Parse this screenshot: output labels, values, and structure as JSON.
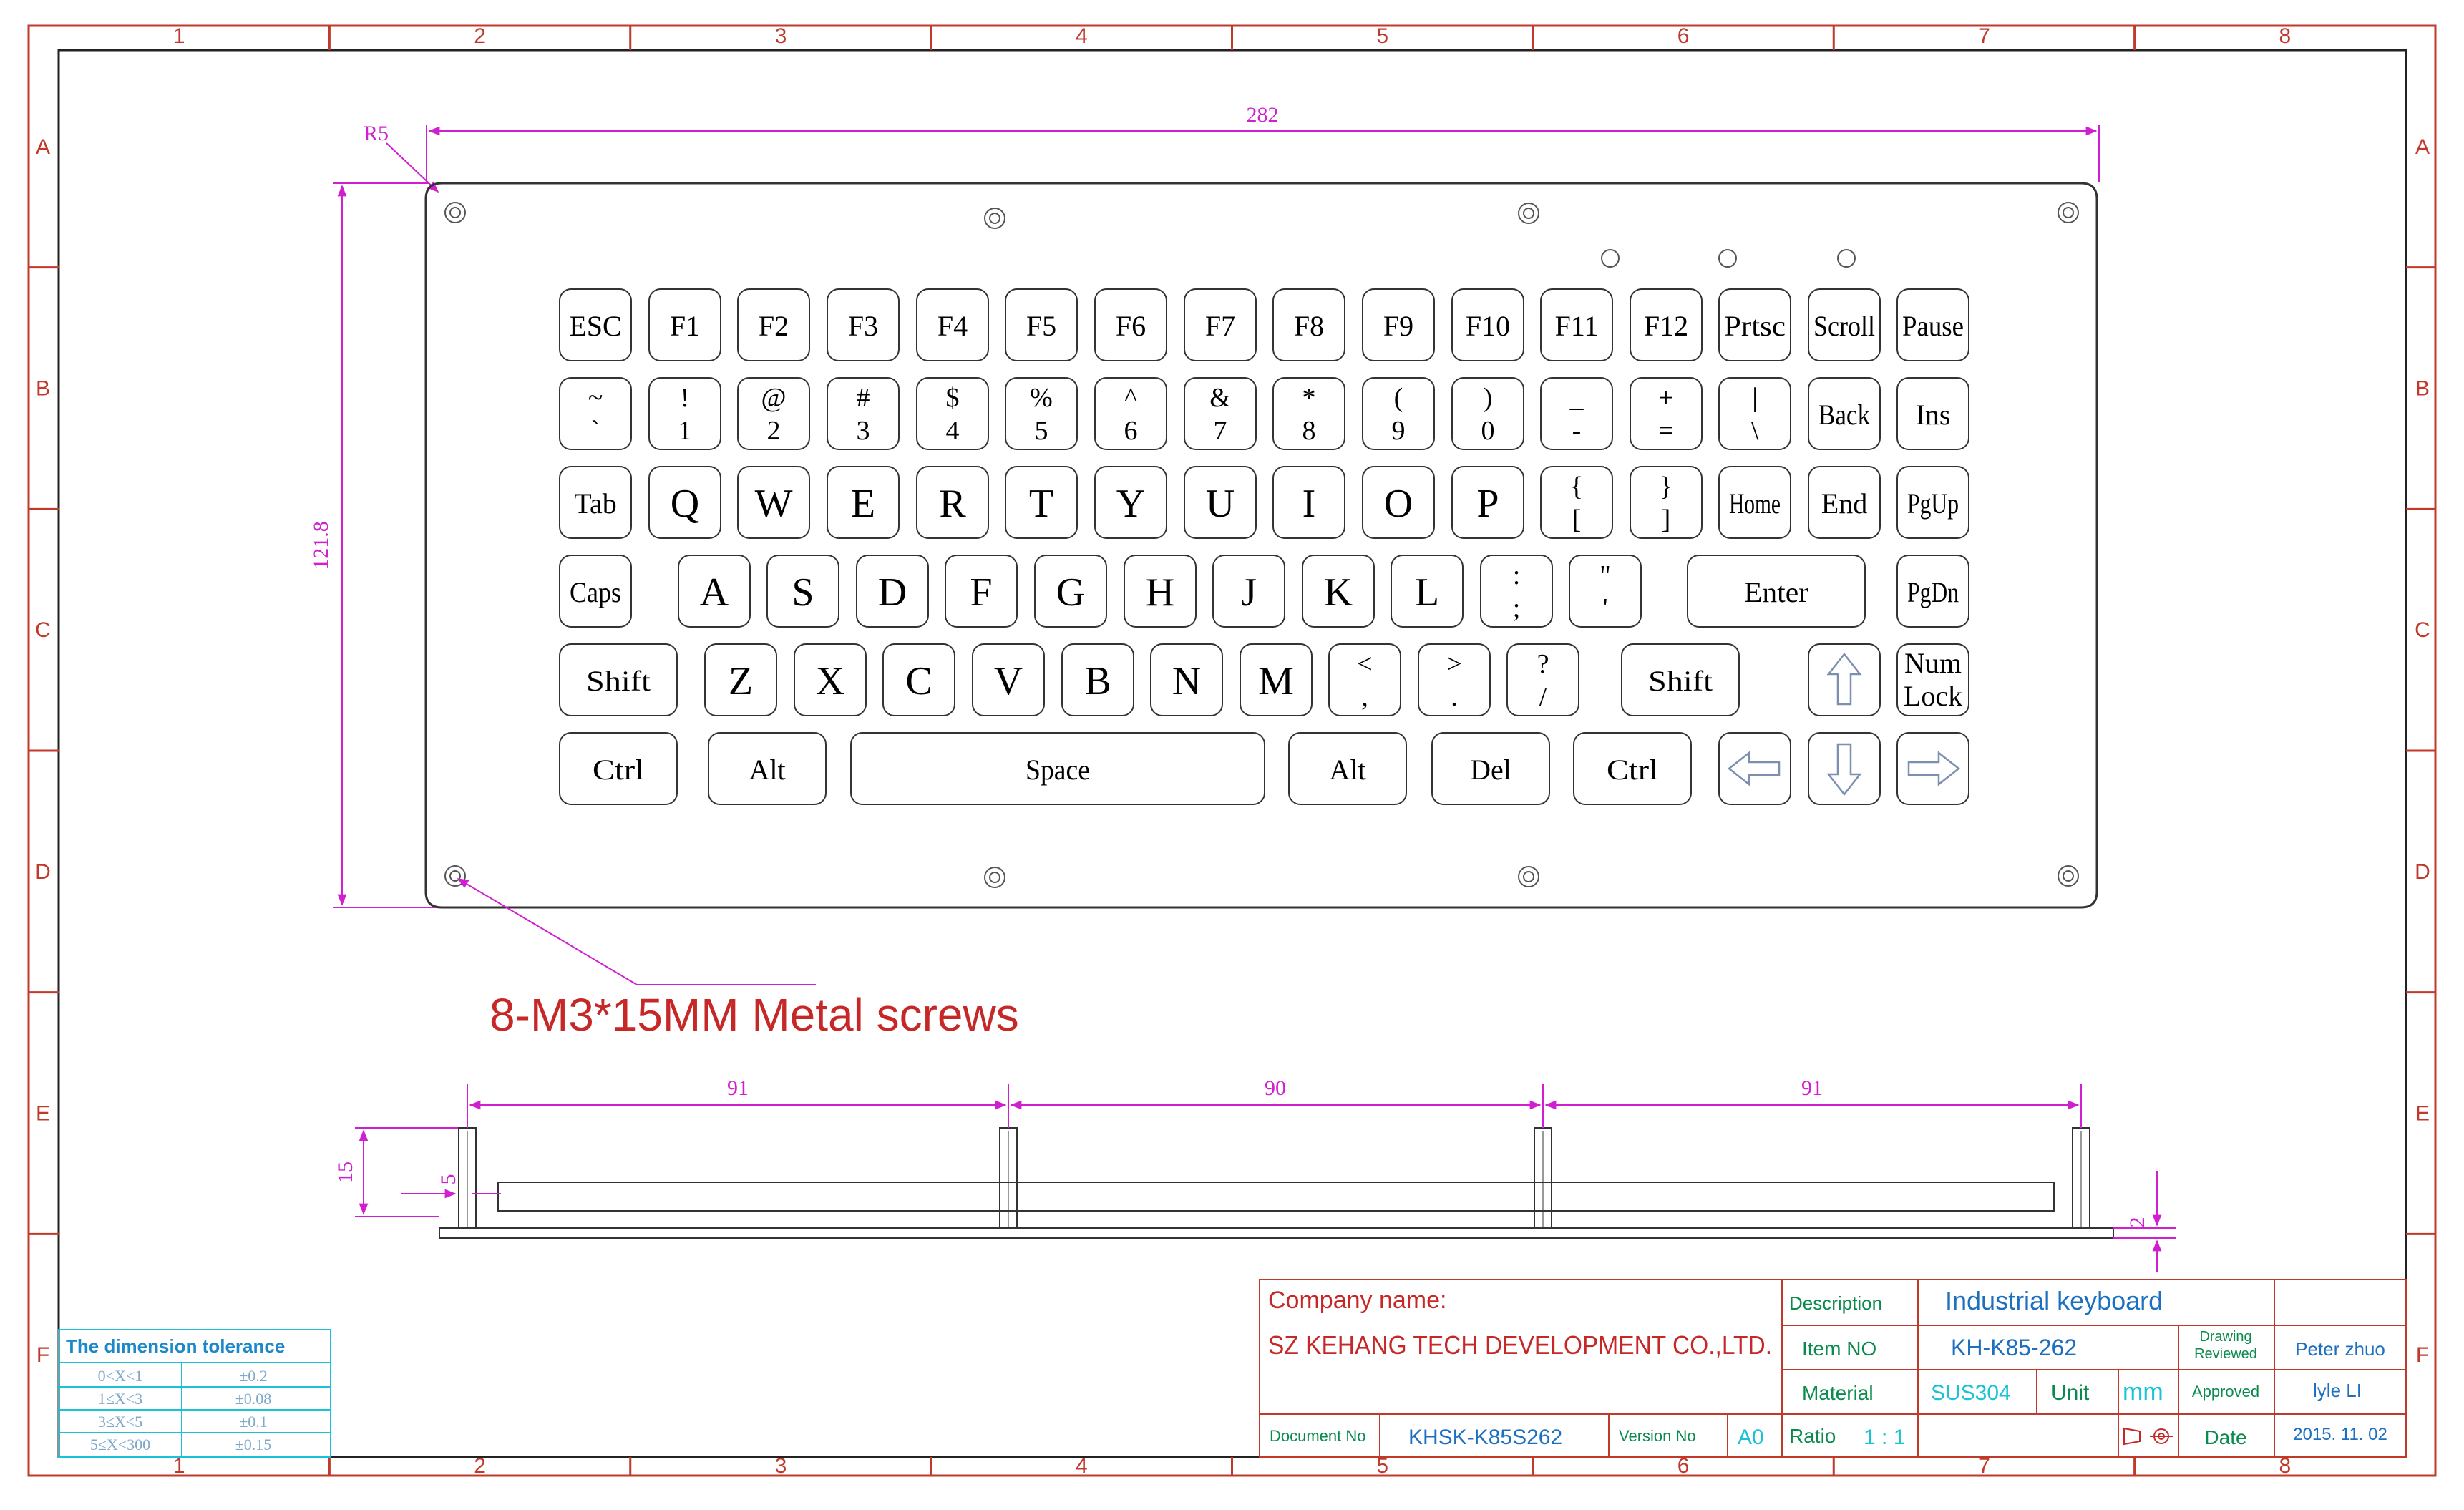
{
  "zones": {
    "columns": [
      "1",
      "2",
      "3",
      "4",
      "5",
      "6",
      "7",
      "8"
    ],
    "rows": [
      "A",
      "B",
      "C",
      "D",
      "E",
      "F"
    ]
  },
  "dimensions": {
    "corner_radius": "R5",
    "width": "282",
    "height": "121.8",
    "side_spacing": [
      "91",
      "90",
      "91"
    ],
    "side_height": "15",
    "side_offset": "5",
    "plate_thickness": "2"
  },
  "screw_note": "8-M3*15MM  Metal screws",
  "keys": [
    [
      {
        "label": "ESC"
      },
      {
        "label": "F1"
      },
      {
        "label": "F2"
      },
      {
        "label": "F3"
      },
      {
        "label": "F4"
      },
      {
        "label": "F5"
      },
      {
        "label": "F6"
      },
      {
        "label": "F7"
      },
      {
        "label": "F8"
      },
      {
        "label": "F9"
      },
      {
        "label": "F10"
      },
      {
        "label": "F11"
      },
      {
        "label": "F12"
      },
      {
        "label": "Prtsc"
      },
      {
        "label": "Scroll"
      },
      {
        "label": "Pause"
      }
    ],
    [
      {
        "top": "~",
        "bottom": "`"
      },
      {
        "top": "!",
        "bottom": "1"
      },
      {
        "top": "@",
        "bottom": "2"
      },
      {
        "top": "#",
        "bottom": "3"
      },
      {
        "top": "$",
        "bottom": "4"
      },
      {
        "top": "%",
        "bottom": "5"
      },
      {
        "top": "^",
        "bottom": "6"
      },
      {
        "top": "&",
        "bottom": "7"
      },
      {
        "top": "*",
        "bottom": "8"
      },
      {
        "top": "(",
        "bottom": "9"
      },
      {
        "top": ")",
        "bottom": "0"
      },
      {
        "top": "_",
        "bottom": "-"
      },
      {
        "top": "+",
        "bottom": "="
      },
      {
        "top": "|",
        "bottom": "\\"
      },
      {
        "label": "Back"
      },
      {
        "label": "Ins"
      }
    ],
    [
      {
        "label": "Tab"
      },
      {
        "label": "Q"
      },
      {
        "label": "W"
      },
      {
        "label": "E"
      },
      {
        "label": "R"
      },
      {
        "label": "T"
      },
      {
        "label": "Y"
      },
      {
        "label": "U"
      },
      {
        "label": "I"
      },
      {
        "label": "O"
      },
      {
        "label": "P"
      },
      {
        "top": "{",
        "bottom": "["
      },
      {
        "top": "}",
        "bottom": "]"
      },
      {
        "label": "Home"
      },
      {
        "label": "End"
      },
      {
        "label": "PgUp"
      }
    ],
    [
      {
        "label": "Caps"
      },
      {
        "label": "A"
      },
      {
        "label": "S"
      },
      {
        "label": "D"
      },
      {
        "label": "F"
      },
      {
        "label": "G"
      },
      {
        "label": "H"
      },
      {
        "label": "J"
      },
      {
        "label": "K"
      },
      {
        "label": "L"
      },
      {
        "top": ":",
        "bottom": ";"
      },
      {
        "top": "\"",
        "bottom": "'"
      },
      {
        "label": "Enter"
      },
      {
        "label": "PgDn"
      }
    ],
    [
      {
        "label": "Shift"
      },
      {
        "label": "Z"
      },
      {
        "label": "X"
      },
      {
        "label": "C"
      },
      {
        "label": "V"
      },
      {
        "label": "B"
      },
      {
        "label": "N"
      },
      {
        "label": "M"
      },
      {
        "top": "<",
        "bottom": ","
      },
      {
        "top": ">",
        "bottom": "."
      },
      {
        "top": "?",
        "bottom": "/"
      },
      {
        "label": "Shift"
      },
      {
        "icon": "arrow-up-icon"
      },
      {
        "top": "Num",
        "bottom": "Lock"
      }
    ],
    [
      {
        "label": "Ctrl"
      },
      {
        "label": "Alt"
      },
      {
        "label": "Space"
      },
      {
        "label": "Alt"
      },
      {
        "label": "Del"
      },
      {
        "label": "Ctrl"
      },
      {
        "icon": "arrow-left-icon"
      },
      {
        "icon": "arrow-down-icon"
      },
      {
        "icon": "arrow-right-icon"
      }
    ]
  ],
  "tolerance_table": {
    "title": "The dimension tolerance",
    "rows": [
      [
        "0<X<1",
        "±0.2"
      ],
      [
        "1≤X<3",
        "±0.08"
      ],
      [
        "3≤X<5",
        "±0.1"
      ],
      [
        "5≤X<300",
        "±0.15"
      ]
    ]
  },
  "title_block": {
    "company_label": "Company name:",
    "company_name": "SZ KEHANG TECH DEVELOPMENT CO.,LTD.",
    "description_label": "Description",
    "description": "Industrial keyboard",
    "item_no_label": "Item NO",
    "item_no": "KH-K85-262",
    "drawing_label": "Drawing",
    "reviewed_label": "Reviewed",
    "reviewer": "Peter zhuo",
    "material_label": "Material",
    "material": "SUS304",
    "unit_label": "Unit",
    "unit": "mm",
    "approved_label": "Approved",
    "approver": "lyle LI",
    "document_no_label": "Document No",
    "document_no": "KHSK-K85S262",
    "version_label": "Version No",
    "version": "A0",
    "ratio_label": "Ratio",
    "ratio": "1 : 1",
    "date_label": "Date",
    "date": "2015. 11. 02"
  },
  "colors": {
    "frame": "#c0392b",
    "dimension": "#d01fd0",
    "outline": "#333333",
    "title_green": "#0b8a4d",
    "title_blue": "#1d6fbf",
    "title_cyan": "#19c2d6",
    "note_red": "#c62828"
  }
}
